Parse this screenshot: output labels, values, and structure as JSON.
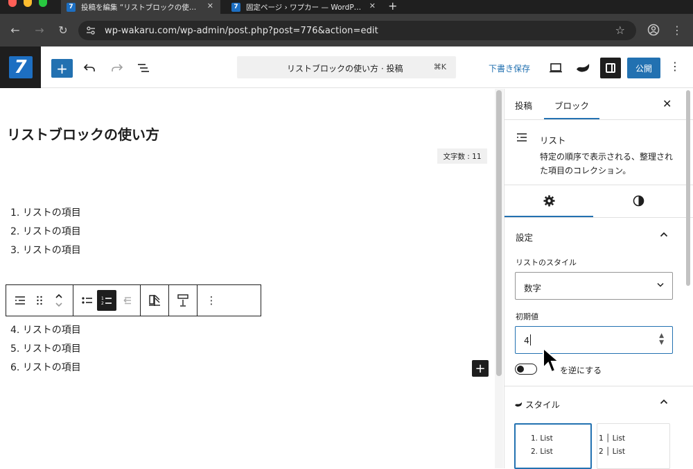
{
  "browser": {
    "tabs": [
      {
        "title": "投稿を編集 “リストブロックの使…",
        "active": true
      },
      {
        "title": "固定ページ › ワプカー — WordP…",
        "active": false
      }
    ],
    "url": "wp-wakaru.com/wp-admin/post.php?post=776&action=edit"
  },
  "header": {
    "logo_text": "7",
    "command_title": "リストブロックの使い方 · 投稿",
    "command_shortcut": "⌘K",
    "save_draft": "下書き保存",
    "publish": "公開"
  },
  "editor": {
    "post_title": "リストブロックの使い方",
    "word_count": "文字数 : 11",
    "list_top": [
      "1. リストの項目",
      "2. リストの項目",
      "3. リストの項目"
    ],
    "list_bottom": [
      "4. リストの項目",
      "5. リストの項目",
      "6. リストの項目"
    ]
  },
  "sidebar": {
    "tabs": [
      "投稿",
      "ブロック"
    ],
    "active_tab": "ブロック",
    "block_name": "リスト",
    "block_description": "特定の順序で表示される、整理された項目のコレクション。",
    "settings_title": "設定",
    "list_style_label": "リストのスタイル",
    "list_style_value": "数字",
    "start_value_label": "初期値",
    "start_value": "4",
    "reverse_label": "順序を逆にする",
    "reverse_label_visible": "を逆にする",
    "styles_title": "スタイル",
    "style_preview_1": [
      "1. List",
      "2. List"
    ],
    "style_preview_2": [
      "1 │ List",
      "2 │ List"
    ]
  },
  "colors": {
    "wp_blue": "#2271b1",
    "dark": "#1e1e1e"
  }
}
